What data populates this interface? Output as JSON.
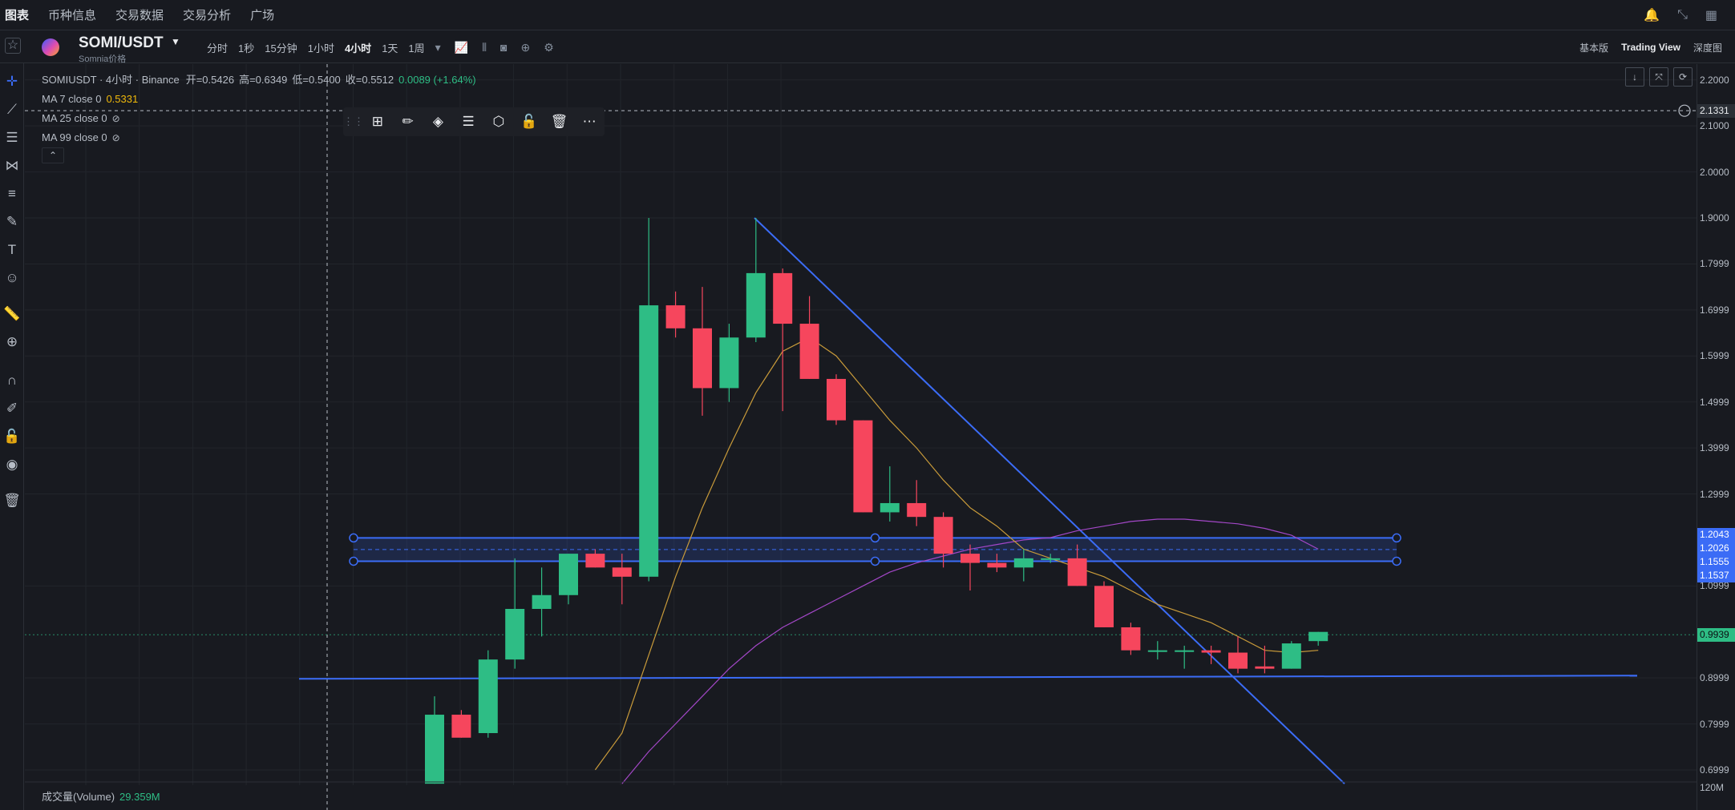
{
  "topnav": {
    "items": [
      "图表",
      "币种信息",
      "交易数据",
      "交易分析",
      "广场"
    ]
  },
  "symbol": {
    "pair": "SOMI/USDT",
    "subtitle": "Somnia价格",
    "intervals": [
      "分时",
      "1秒",
      "15分钟",
      "1小时",
      "4小时",
      "1天",
      "1周"
    ],
    "active_interval": "4小时",
    "views": [
      "基本版",
      "Trading View",
      "深度图"
    ],
    "active_view": "Trading View"
  },
  "legend": {
    "title": "SOMIUSDT · 4小时 · Binance",
    "open_label": "开=0.5426",
    "high_label": "高=0.6349",
    "low_label": "低=0.5400",
    "close_label": "收=0.5512",
    "change": "0.0089 (+1.64%)",
    "ma7": "MA 7 close 0",
    "ma7_value": "0.5331",
    "ma25": "MA 25 close 0",
    "ma99": "MA 99 close 0"
  },
  "volume": {
    "label": "成交量(Volume)",
    "value": "29.359M",
    "axis_tick": "120M"
  },
  "price_axis": {
    "ticks": [
      "2.2000",
      "2.1000",
      "2.0000",
      "1.9000",
      "1.7999",
      "1.6999",
      "1.5999",
      "1.4999",
      "1.3999",
      "1.2999",
      "1.0999",
      "0.8999",
      "0.7999",
      "0.6999"
    ],
    "crosshair_label": "2.1331",
    "zone_labels": [
      "1.2043",
      "1.2026",
      "1.1555",
      "1.1537"
    ],
    "last_price_label": "0.9939"
  },
  "colors": {
    "up": "#2ebd85",
    "down": "#f6465d",
    "ma7": "#c99b3a",
    "ma99": "#a347c7",
    "drawing": "#3b6cf6"
  },
  "chart_data": {
    "type": "candlestick",
    "interval": "4h",
    "ylim": [
      0.67,
      2.26
    ],
    "tick_values": [
      2.2,
      2.1,
      2.0,
      1.9,
      1.7999,
      1.6999,
      1.5999,
      1.4999,
      1.3999,
      1.2999,
      1.0999,
      0.8999,
      0.7999,
      0.6999
    ],
    "candles": [
      {
        "o": 0.67,
        "h": 0.86,
        "l": 0.67,
        "c": 0.82
      },
      {
        "o": 0.82,
        "h": 0.83,
        "l": 0.77,
        "c": 0.77
      },
      {
        "o": 0.78,
        "h": 0.96,
        "l": 0.77,
        "c": 0.94
      },
      {
        "o": 0.94,
        "h": 1.16,
        "l": 0.92,
        "c": 1.05
      },
      {
        "o": 1.05,
        "h": 1.14,
        "l": 0.99,
        "c": 1.08
      },
      {
        "o": 1.08,
        "h": 1.17,
        "l": 1.06,
        "c": 1.17
      },
      {
        "o": 1.17,
        "h": 1.18,
        "l": 1.14,
        "c": 1.14
      },
      {
        "o": 1.14,
        "h": 1.17,
        "l": 1.06,
        "c": 1.12
      },
      {
        "o": 1.12,
        "h": 1.9,
        "l": 1.11,
        "c": 1.71
      },
      {
        "o": 1.71,
        "h": 1.74,
        "l": 1.64,
        "c": 1.66
      },
      {
        "o": 1.66,
        "h": 1.75,
        "l": 1.47,
        "c": 1.53
      },
      {
        "o": 1.53,
        "h": 1.67,
        "l": 1.5,
        "c": 1.64
      },
      {
        "o": 1.64,
        "h": 1.9,
        "l": 1.63,
        "c": 1.78
      },
      {
        "o": 1.78,
        "h": 1.79,
        "l": 1.48,
        "c": 1.67
      },
      {
        "o": 1.67,
        "h": 1.73,
        "l": 1.55,
        "c": 1.55
      },
      {
        "o": 1.55,
        "h": 1.56,
        "l": 1.45,
        "c": 1.46
      },
      {
        "o": 1.46,
        "h": 1.46,
        "l": 1.26,
        "c": 1.26
      },
      {
        "o": 1.26,
        "h": 1.36,
        "l": 1.24,
        "c": 1.28
      },
      {
        "o": 1.28,
        "h": 1.33,
        "l": 1.23,
        "c": 1.25
      },
      {
        "o": 1.25,
        "h": 1.26,
        "l": 1.14,
        "c": 1.17
      },
      {
        "o": 1.17,
        "h": 1.19,
        "l": 1.09,
        "c": 1.15
      },
      {
        "o": 1.15,
        "h": 1.17,
        "l": 1.13,
        "c": 1.14
      },
      {
        "o": 1.14,
        "h": 1.18,
        "l": 1.11,
        "c": 1.16
      },
      {
        "o": 1.16,
        "h": 1.17,
        "l": 1.15,
        "c": 1.16
      },
      {
        "o": 1.16,
        "h": 1.19,
        "l": 1.1,
        "c": 1.1
      },
      {
        "o": 1.1,
        "h": 1.11,
        "l": 1.01,
        "c": 1.01
      },
      {
        "o": 1.01,
        "h": 1.02,
        "l": 0.95,
        "c": 0.96
      },
      {
        "o": 0.96,
        "h": 0.98,
        "l": 0.94,
        "c": 0.96
      },
      {
        "o": 0.96,
        "h": 0.97,
        "l": 0.92,
        "c": 0.96
      },
      {
        "o": 0.96,
        "h": 0.97,
        "l": 0.93,
        "c": 0.955
      },
      {
        "o": 0.955,
        "h": 0.99,
        "l": 0.91,
        "c": 0.92
      },
      {
        "o": 0.925,
        "h": 0.97,
        "l": 0.91,
        "c": 0.92
      },
      {
        "o": 0.92,
        "h": 0.98,
        "l": 0.92,
        "c": 0.975
      },
      {
        "o": 0.98,
        "h": 1.0,
        "l": 0.97,
        "c": 1.0
      }
    ],
    "ma7": [
      null,
      null,
      null,
      null,
      null,
      null,
      0.7,
      0.78,
      0.95,
      1.12,
      1.27,
      1.4,
      1.52,
      1.61,
      1.64,
      1.6,
      1.53,
      1.46,
      1.4,
      1.33,
      1.27,
      1.23,
      1.18,
      1.16,
      1.14,
      1.12,
      1.09,
      1.06,
      1.04,
      1.02,
      0.99,
      0.96,
      0.955,
      0.96
    ],
    "ma99": [
      null,
      null,
      null,
      null,
      null,
      null,
      null,
      0.67,
      0.74,
      0.8,
      0.86,
      0.92,
      0.97,
      1.01,
      1.04,
      1.07,
      1.1,
      1.13,
      1.15,
      1.165,
      1.18,
      1.19,
      1.2,
      1.205,
      1.22,
      1.23,
      1.24,
      1.245,
      1.245,
      1.24,
      1.235,
      1.225,
      1.21,
      1.18
    ],
    "drawings": {
      "zone": {
        "top": 1.2043,
        "top_inner": 1.2026,
        "bottom_inner": 1.1555,
        "bottom": 1.1537
      },
      "trendline": {
        "start": 1.9,
        "end": 0.67
      },
      "support_line": {
        "start": 0.898,
        "end": 0.905
      }
    }
  }
}
